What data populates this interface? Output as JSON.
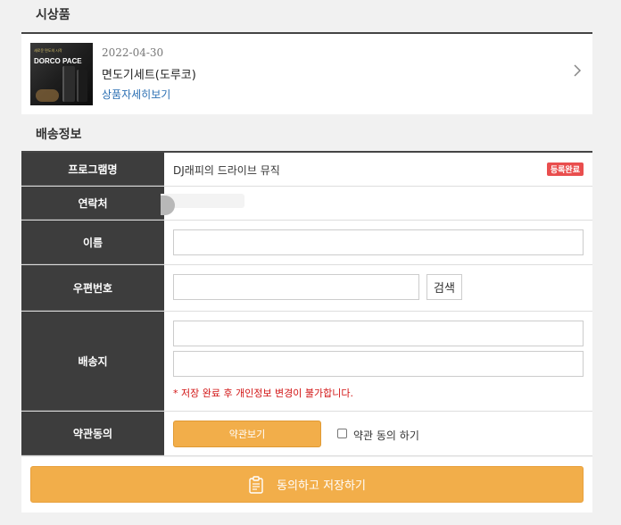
{
  "prize_section": {
    "title": "시상품",
    "item": {
      "date": "2022-04-30",
      "name": "면도기세트(도루코)",
      "detail_link": "상품자세히보기",
      "thumbnail": {
        "top_text": "새로운 면도의 시작",
        "brand_text": "DORCO PACE"
      }
    }
  },
  "shipping_section": {
    "title": "배송정보",
    "rows": {
      "program": {
        "label": "프로그램명",
        "value": "DJ래피의 드라이브 뮤직",
        "badge": "등록완료",
        "badge_color": "#e94e4e"
      },
      "contact": {
        "label": "연락처"
      },
      "name": {
        "label": "이름",
        "value": "",
        "placeholder": ""
      },
      "zipcode": {
        "label": "우편번호",
        "value": "",
        "search_button": "검색"
      },
      "address": {
        "label": "배송지",
        "line1": "",
        "line2": "",
        "notice": "* 저장 완료 후 개인정보 변경이 불가합니다."
      },
      "terms": {
        "label": "약관동의",
        "view_button": "약관보기",
        "agree_checkbox_label": "약관 동의 하기",
        "agree_checked": false
      }
    }
  },
  "save_button": {
    "label": "동의하고 저장하기",
    "icon": "clipboard-icon"
  },
  "colors": {
    "accent": "#f2ae4a",
    "label_bg": "#3d3d3d",
    "link": "#2b6fb3",
    "notice": "#d21414"
  }
}
